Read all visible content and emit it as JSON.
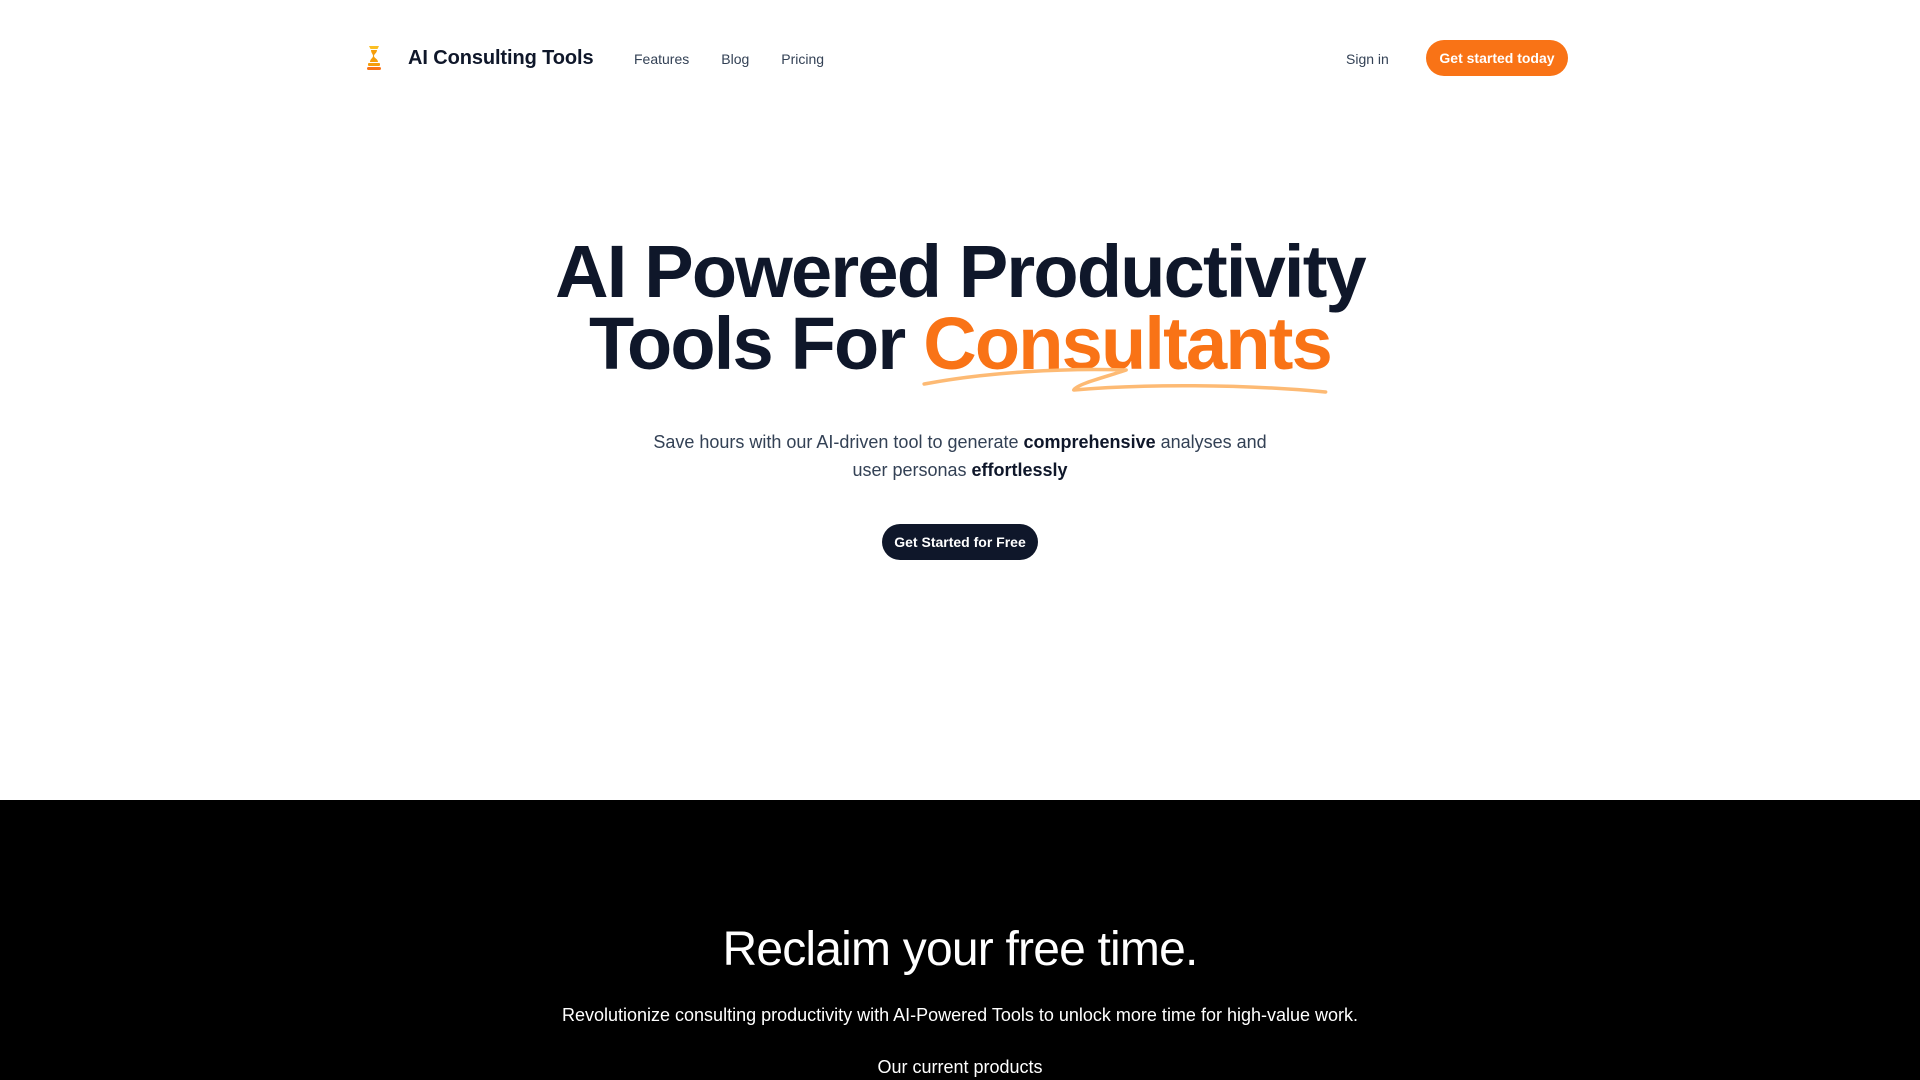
{
  "header": {
    "brand": "AI Consulting Tools",
    "brand_icon": "chess-piece-icon",
    "nav": [
      {
        "label": "Features"
      },
      {
        "label": "Blog"
      },
      {
        "label": "Pricing"
      }
    ],
    "sign_in": "Sign in",
    "cta": "Get started today"
  },
  "hero": {
    "title_line1": "AI Powered Productivity",
    "title_line2_prefix": "Tools For ",
    "title_accent": "Consultants",
    "subtitle_part1": "Save hours with our AI-driven tool to generate ",
    "subtitle_bold1": "comprehensive",
    "subtitle_part2": " analyses and user personas ",
    "subtitle_bold2": "effortlessly",
    "cta": "Get Started for Free"
  },
  "feature_section": {
    "title": "Reclaim your free time.",
    "subtitle": "Revolutionize consulting productivity with AI-Powered Tools to unlock more time for high-value work.",
    "products_label": "Our current products"
  },
  "colors": {
    "accent": "#f97316",
    "dark": "#0f172a",
    "text": "#334155",
    "underline": "#fdba74",
    "section_bg": "#000000"
  }
}
